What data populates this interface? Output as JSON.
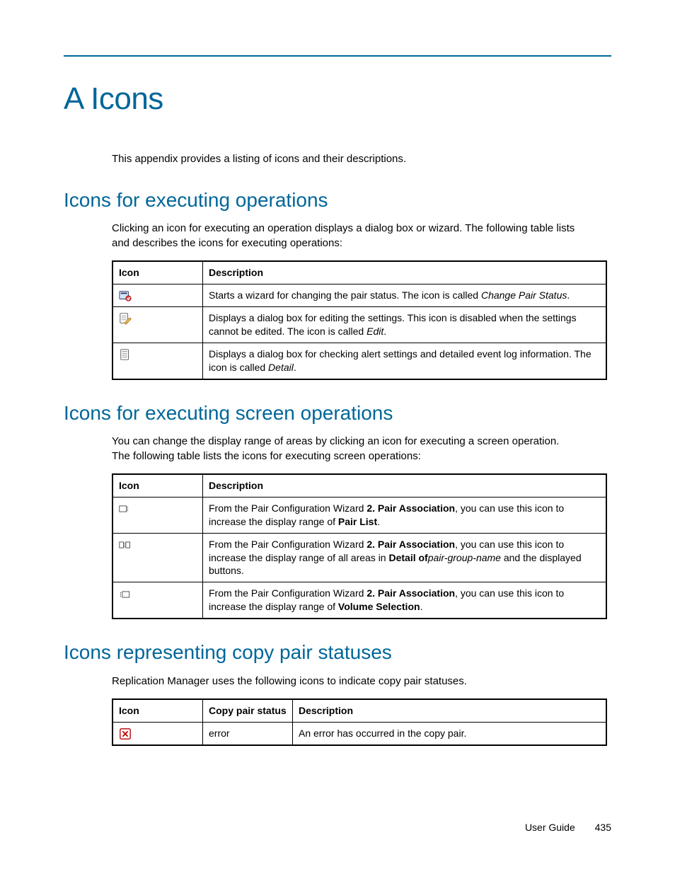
{
  "appendix": {
    "title": "A Icons",
    "intro": "This appendix provides a listing of icons and their descriptions."
  },
  "columns": {
    "icon": "Icon",
    "description": "Description",
    "copy_pair_status": "Copy pair status"
  },
  "section1": {
    "heading": "Icons for executing operations",
    "para": "Clicking an icon for executing an operation displays a dialog box or wizard. The following table lists and describes the icons for executing operations:",
    "rows": [
      {
        "icon_name": "change-pair-status-icon",
        "desc_pre": "Starts a wizard for changing the pair status. The icon is called ",
        "desc_em": "Change Pair Status",
        "desc_post": "."
      },
      {
        "icon_name": "edit-icon",
        "desc_pre": "Displays a dialog box for editing the settings. This icon is disabled when the settings cannot be edited. The icon is called ",
        "desc_em": "Edit",
        "desc_post": "."
      },
      {
        "icon_name": "detail-icon",
        "desc_pre": "Displays a dialog box for checking alert settings and detailed event log information. The icon is called ",
        "desc_em": "Detail",
        "desc_post": "."
      }
    ]
  },
  "section2": {
    "heading": "Icons for executing screen operations",
    "para": "You can change the display range of areas by clicking an icon for executing a screen operation. The following table lists the icons for executing screen operations:",
    "rows": [
      {
        "icon_name": "expand-pair-list-icon",
        "pre": "From the Pair Configuration Wizard ",
        "b1": "2. Pair Association",
        "mid1": ", you can use this icon to increase the display range of ",
        "b2": "Pair List",
        "post": "."
      },
      {
        "icon_name": "expand-detail-icon",
        "pre": "From the Pair Configuration Wizard ",
        "b1": "2. Pair Association",
        "mid1": ", you can use this icon to increase the display range of all areas in ",
        "b2": "Detail of",
        "em": "pair-group-name",
        "post": " and the displayed buttons."
      },
      {
        "icon_name": "expand-volume-selection-icon",
        "pre": "From the Pair Configuration Wizard ",
        "b1": "2. Pair Association",
        "mid1": ", you can use this icon to increase the display range of ",
        "b2": "Volume Selection",
        "post": "."
      }
    ]
  },
  "section3": {
    "heading": "Icons representing copy pair statuses",
    "para": "Replication Manager uses the following icons to indicate copy pair statuses.",
    "rows": [
      {
        "icon_name": "error-status-icon",
        "status": "error",
        "desc": "An error has occurred in the copy pair."
      }
    ]
  },
  "footer": {
    "guide": "User Guide",
    "page": "435"
  }
}
